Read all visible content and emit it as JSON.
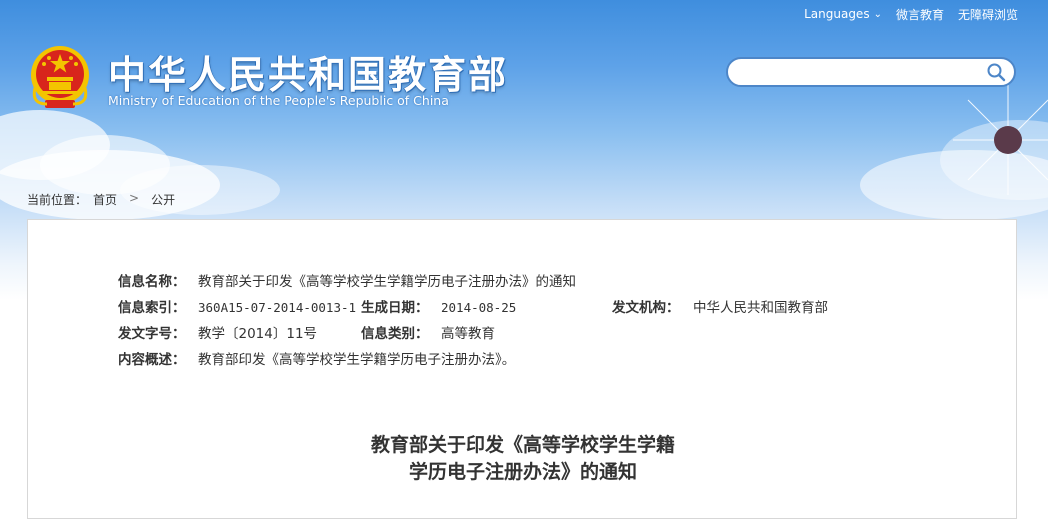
{
  "header": {
    "title_cn": "中华人民共和国教育部",
    "title_en": "Ministry of Education of the People's Republic of China",
    "links": {
      "languages": "Languages",
      "weibo": "微言教育",
      "accessibility": "无障碍浏览"
    },
    "search": {
      "placeholder": ""
    }
  },
  "breadcrumb": {
    "prefix": "当前位置：",
    "items": [
      "首页",
      "公开"
    ],
    "separator": ">"
  },
  "meta": {
    "name_label": "信息名称：",
    "name_value": "教育部关于印发《高等学校学生学籍学历电子注册办法》的通知",
    "index_label": "信息索引：",
    "index_value": "360A15-07-2014-0013-1",
    "date_label": "生成日期：",
    "date_value": "2014-08-25",
    "org_label": "发文机构：",
    "org_value": "中华人民共和国教育部",
    "docno_label": "发文字号：",
    "docno_value": "教学〔2014〕11号",
    "category_label": "信息类别：",
    "category_value": "高等教育",
    "summary_label": "内容概述：",
    "summary_value": "教育部印发《高等学校学生学籍学历电子注册办法》。"
  },
  "document": {
    "title_line1": "教育部关于印发《高等学校学生学籍",
    "title_line2": "学历电子注册办法》的通知"
  },
  "colors": {
    "sky_top": "#3f8ede",
    "border_blue": "#4d86c8",
    "emblem_red": "#d8251c",
    "emblem_gold": "#f4c400"
  }
}
